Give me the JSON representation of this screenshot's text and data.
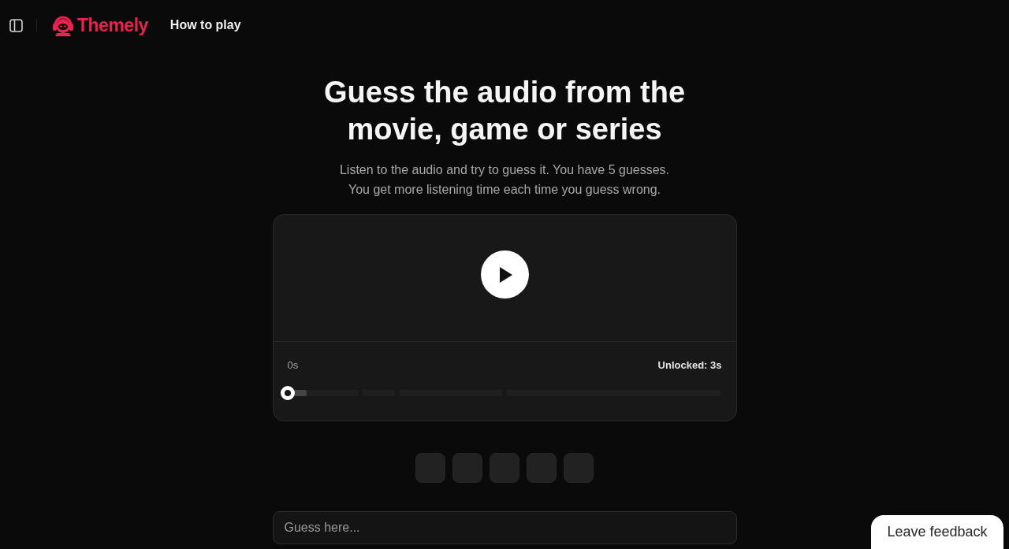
{
  "header": {
    "brand": "Themely",
    "nav_link": "How to play"
  },
  "hero": {
    "title_lines": [
      "Guess the audio from the",
      "movie, game or series"
    ],
    "subtitle_lines": [
      "Listen to the audio and try to guess it. You have 5 guesses.",
      "You get more listening time each time you guess wrong."
    ]
  },
  "player": {
    "playing": false,
    "elapsed": "0s",
    "unlocked": "Unlocked: 3s",
    "track": {
      "level": 0,
      "unlocked_part": {
        "level": 0.045
      }
    }
  },
  "guess_slots": [
    {
      "filled": false
    },
    {
      "filled": false
    },
    {
      "filled": false
    },
    {
      "filled": false
    },
    {
      "filled": false
    }
  ],
  "guess_field": {
    "placeholder": "Guess here..."
  },
  "feedback_button": {
    "label": "Leave feedback"
  }
}
